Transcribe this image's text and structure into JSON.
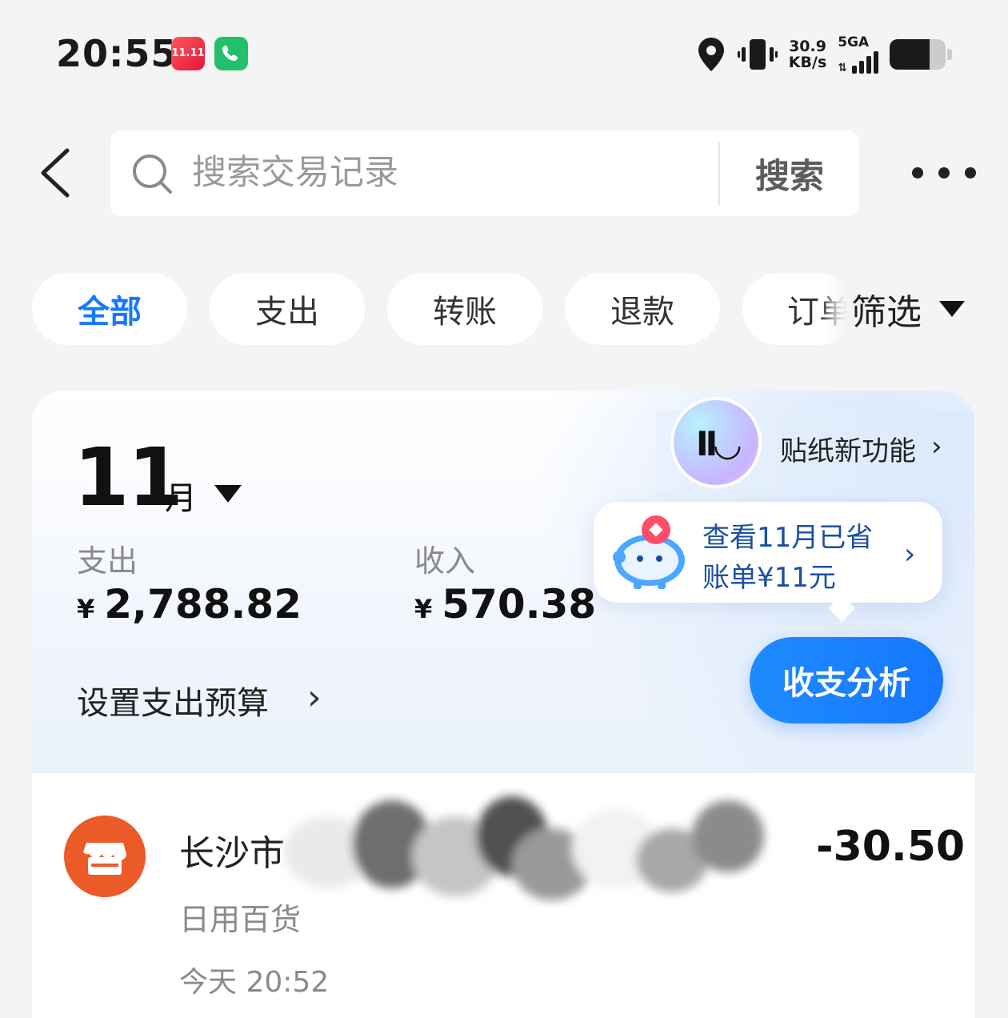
{
  "status_bar": {
    "time": "20:55",
    "app1_label": "11.11",
    "speed_value": "30.9",
    "speed_unit": "KB/s",
    "network": "5GA",
    "battery_level": 0.72,
    "icons": [
      "location-pin-icon",
      "vibrate-icon",
      "signal-icon",
      "battery-icon"
    ]
  },
  "search": {
    "placeholder": "搜索交易记录",
    "value": "",
    "button_label": "搜索"
  },
  "tabs": [
    {
      "label": "全部",
      "active": true
    },
    {
      "label": "支出",
      "active": false
    },
    {
      "label": "转账",
      "active": false
    },
    {
      "label": "退款",
      "active": false
    },
    {
      "label": "订单",
      "active": false
    }
  ],
  "filter": {
    "label": "筛选"
  },
  "summary": {
    "month": "11",
    "month_unit": "月",
    "sticker_label": "贴纸新功能",
    "sticker_arrow": "›",
    "expense_label": "支出",
    "expense_currency": "¥",
    "expense_value": "2,788.82",
    "income_label": "收入",
    "income_currency": "¥",
    "income_value": "570.38",
    "budget_label": "设置支出预算",
    "budget_arrow": "›",
    "saved_line1": "查看11月已省",
    "saved_line2": "账单¥11元",
    "saved_arrow": "›",
    "analysis_button": "收支分析"
  },
  "transactions": [
    {
      "title_visible": "长沙市",
      "amount": "-30.50",
      "category": "日用百货",
      "time": "今天 20:52"
    }
  ],
  "colors": {
    "accent": "#1677ff",
    "merchant_icon": "#ec5a28",
    "background": "#f4f4f4"
  }
}
